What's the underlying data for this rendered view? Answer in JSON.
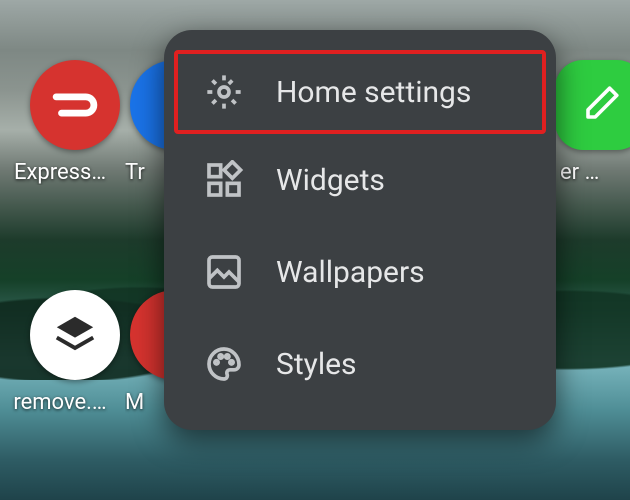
{
  "apps": {
    "express": {
      "label": "Express…"
    },
    "tr": {
      "label": "Tr"
    },
    "er": {
      "label": "er …"
    },
    "remove": {
      "label": "remove.…"
    },
    "m": {
      "label": "M"
    }
  },
  "menu": {
    "items": [
      {
        "label": "Home settings",
        "highlight": true
      },
      {
        "label": "Widgets",
        "highlight": false
      },
      {
        "label": "Wallpapers",
        "highlight": false
      },
      {
        "label": "Styles",
        "highlight": false
      }
    ]
  }
}
